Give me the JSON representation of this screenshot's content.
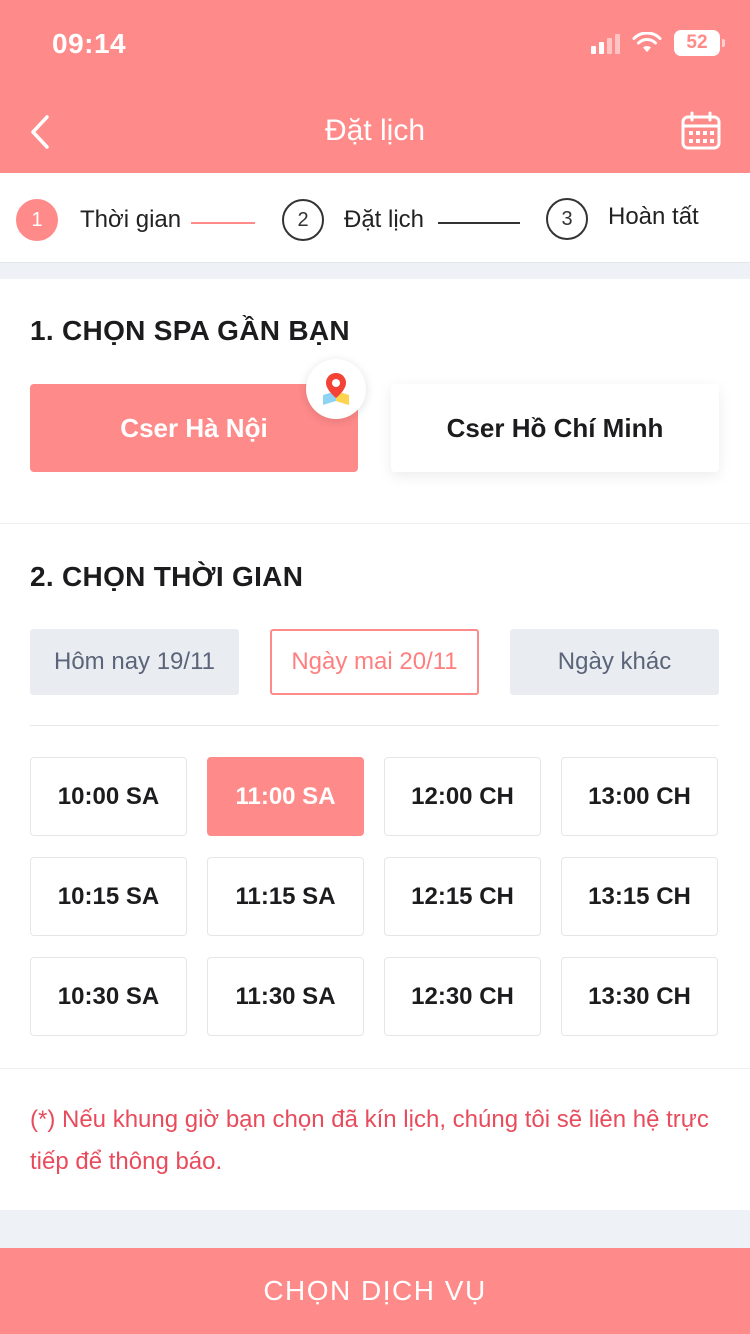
{
  "status_bar": {
    "time": "09:14",
    "battery": "52"
  },
  "header": {
    "title": "Đặt lịch",
    "back_icon": "chevron-left-icon",
    "calendar_icon": "calendar-icon"
  },
  "stepper": {
    "steps": [
      {
        "number": "1",
        "label": "Thời gian",
        "active": true
      },
      {
        "number": "2",
        "label": "Đặt lịch",
        "active": false
      },
      {
        "number": "3",
        "label": "Hoàn tất",
        "active": false
      }
    ]
  },
  "spa_section": {
    "title": "1. CHỌN SPA GẦN BẠN",
    "options": [
      {
        "label": "Cser Hà Nội",
        "selected": true
      },
      {
        "label": "Cser Hồ Chí Minh",
        "selected": false
      }
    ]
  },
  "time_section": {
    "title": "2. CHỌN THỜI GIAN",
    "dates": [
      {
        "label": "Hôm nay 19/11",
        "selected": false
      },
      {
        "label": "Ngày mai 20/11",
        "selected": true
      },
      {
        "label": "Ngày khác",
        "selected": false
      }
    ],
    "slots": [
      {
        "label": "10:00 SA",
        "selected": false
      },
      {
        "label": "11:00 SA",
        "selected": true
      },
      {
        "label": "12:00 CH",
        "selected": false
      },
      {
        "label": "13:00 CH",
        "selected": false
      },
      {
        "label": "10:15 SA",
        "selected": false
      },
      {
        "label": "11:15 SA",
        "selected": false
      },
      {
        "label": "12:15 CH",
        "selected": false
      },
      {
        "label": "13:15 CH",
        "selected": false
      },
      {
        "label": "10:30 SA",
        "selected": false
      },
      {
        "label": "11:30 SA",
        "selected": false
      },
      {
        "label": "12:30 CH",
        "selected": false
      },
      {
        "label": "13:30 CH",
        "selected": false
      }
    ]
  },
  "note": "(*) Nếu khung giờ bạn chọn đã kín lịch, chúng tôi sẽ liên hệ trực tiếp để thông báo.",
  "cta_label": "CHỌN DỊCH VỤ",
  "colors": {
    "accent": "#ff8a8a",
    "note": "#e84c5c",
    "grey_button": "#e9edf2"
  }
}
